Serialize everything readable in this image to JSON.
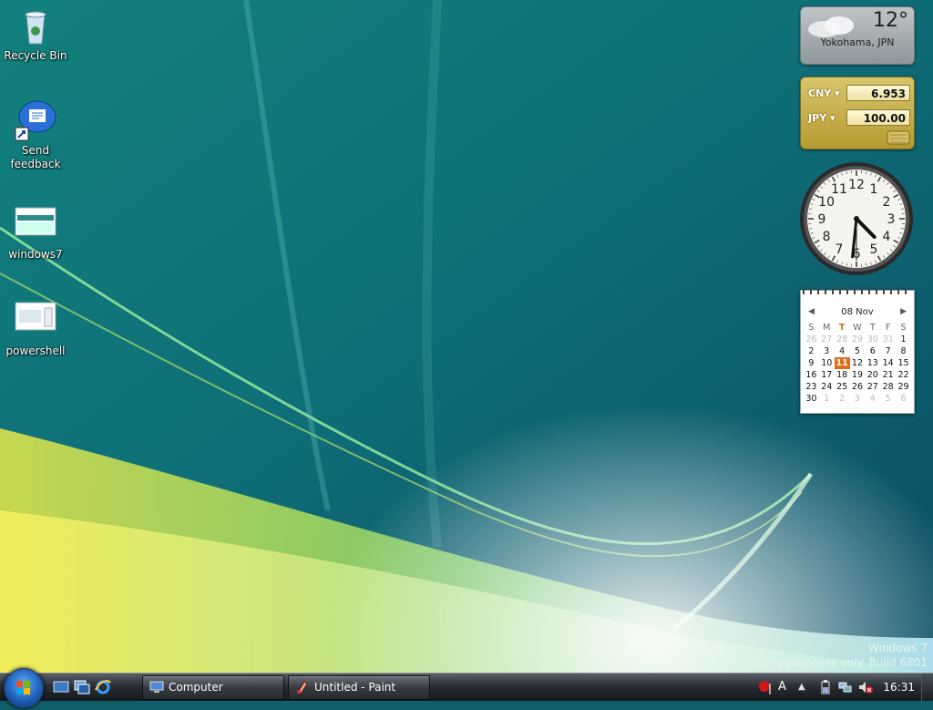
{
  "desktop": {
    "icons": [
      {
        "label": "Recycle Bin",
        "icon": "recycle-bin-icon"
      },
      {
        "label": "Send feedback",
        "icon": "feedback-icon"
      },
      {
        "label": "windows7",
        "icon": "image-file-icon"
      },
      {
        "label": "powershell",
        "icon": "image-file-icon"
      }
    ],
    "watermark": {
      "line1": "Windows 7",
      "line2": "For testing purposes only. Build 6801"
    }
  },
  "gadgets": {
    "weather": {
      "temperature": "12°",
      "city": "Yokohama, JPN"
    },
    "currency": {
      "rows": [
        {
          "code": "CNY",
          "value": "6.953"
        },
        {
          "code": "JPY",
          "value": "100.00"
        }
      ]
    },
    "clock": {
      "hour": 4,
      "minute": 31,
      "second": 30,
      "numerals": [
        "12",
        "1",
        "2",
        "3",
        "4",
        "5",
        "6",
        "7",
        "8",
        "9",
        "10",
        "11"
      ]
    },
    "calendar": {
      "header": "08 Nov",
      "prev": "◀",
      "next": "▶",
      "weekdays": [
        "S",
        "M",
        "T",
        "W",
        "T",
        "F",
        "S"
      ],
      "today_weekday_index": 2,
      "weeks": [
        [
          "26",
          "27",
          "28",
          "29",
          "30",
          "31",
          "1"
        ],
        [
          "2",
          "3",
          "4",
          "5",
          "6",
          "7",
          "8"
        ],
        [
          "9",
          "10",
          "11",
          "12",
          "13",
          "14",
          "15"
        ],
        [
          "16",
          "17",
          "18",
          "19",
          "20",
          "21",
          "22"
        ],
        [
          "23",
          "24",
          "25",
          "26",
          "27",
          "28",
          "29"
        ],
        [
          "30",
          "1",
          "2",
          "3",
          "4",
          "5",
          "6"
        ]
      ],
      "selected": "11"
    }
  },
  "taskbar": {
    "buttons": [
      {
        "label": "Computer",
        "icon": "computer-icon"
      },
      {
        "label": "Untitled - Paint",
        "icon": "paint-icon"
      }
    ],
    "quick_launch": [
      "show-desktop-icon",
      "switch-windows-icon",
      "internet-explorer-icon"
    ],
    "tray": {
      "time": "16:31",
      "icons": [
        "alert-flag-icon",
        "language-icon",
        "show-hidden-icon",
        "power-icon",
        "network-icon",
        "volume-muted-icon"
      ]
    }
  },
  "colors": {
    "taskbar": "#1c2024",
    "calendar_selected": "#e36c1b",
    "currency_gold": "#c8ae48"
  }
}
